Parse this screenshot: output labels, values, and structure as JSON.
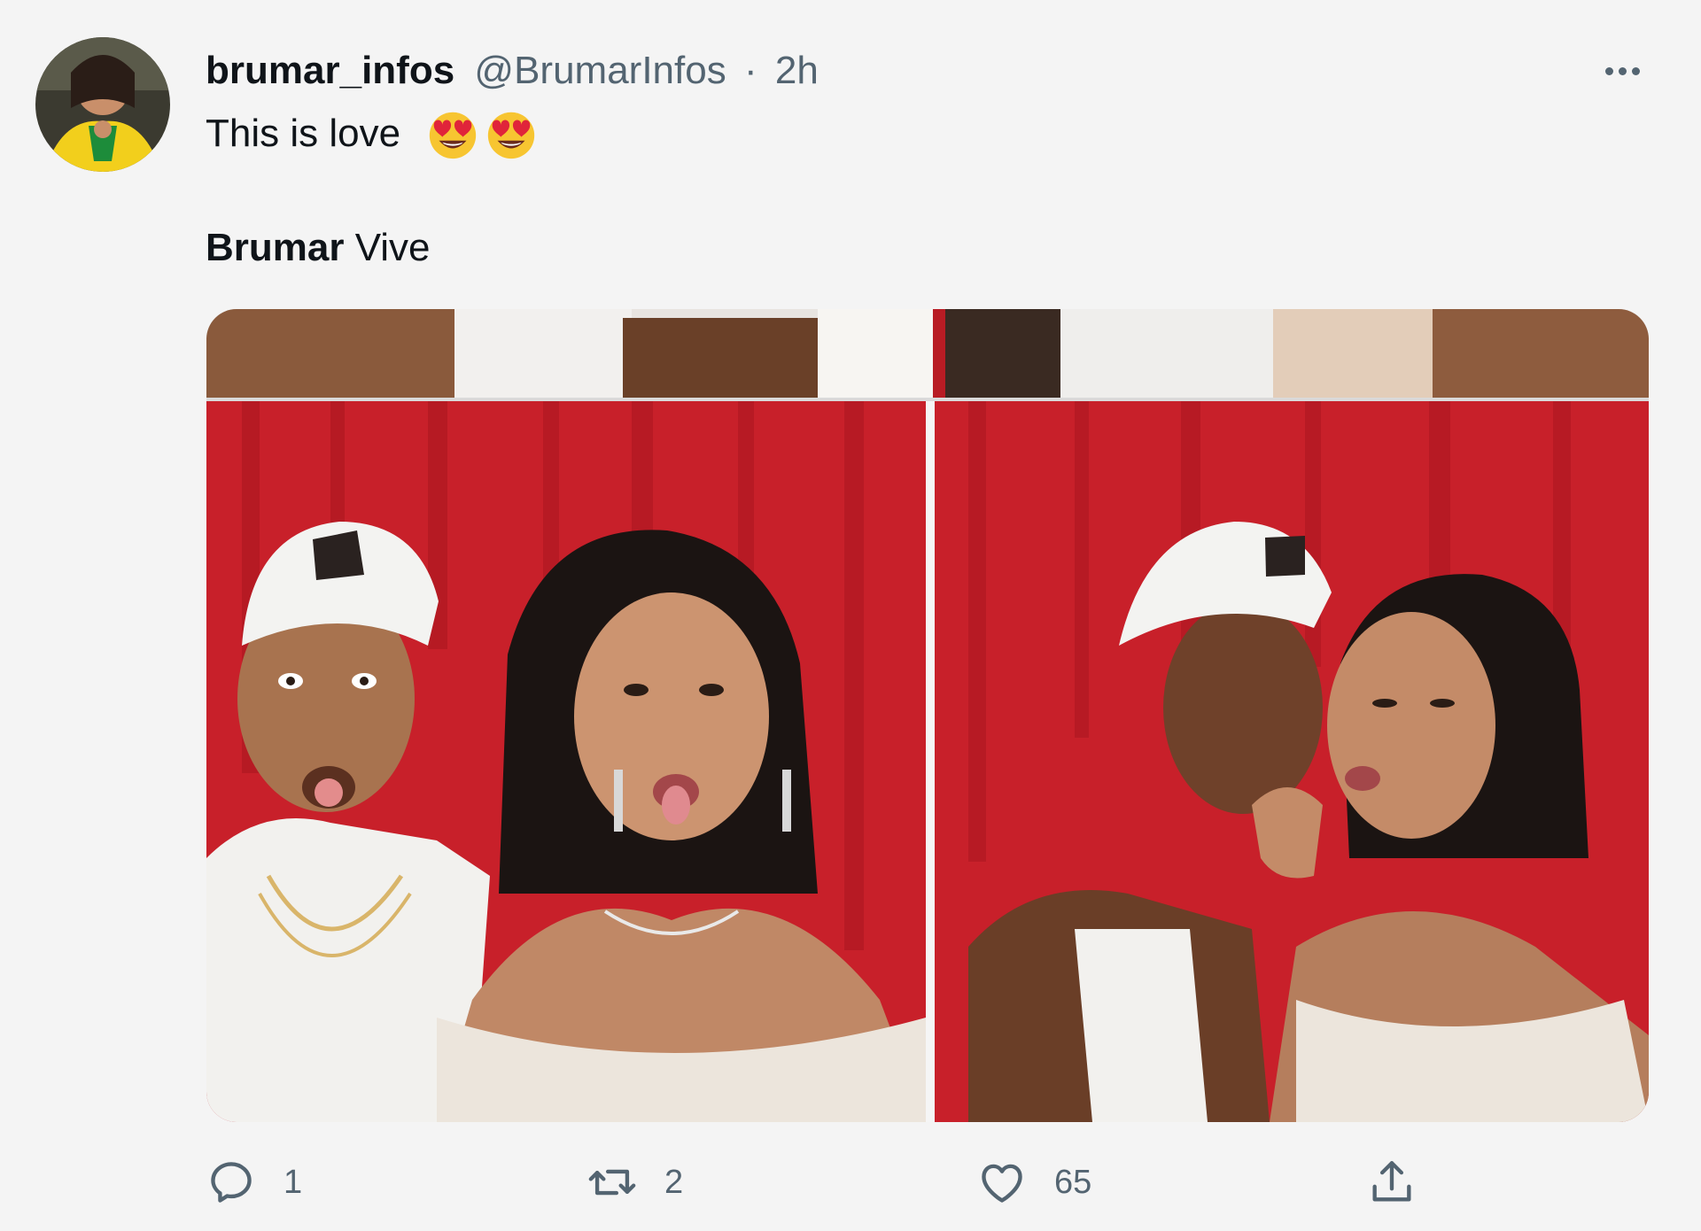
{
  "tweet": {
    "display_name": "brumar_infos",
    "handle": "@BrumarInfos",
    "separator": "·",
    "time": "2h",
    "text": "This is love",
    "emojis": [
      "smiling-face-with-heart-eyes",
      "smiling-face-with-heart-eyes"
    ],
    "quote_bold": "Brumar",
    "quote_rest": " Vive"
  },
  "actions": {
    "reply_count": "1",
    "retweet_count": "2",
    "like_count": "65",
    "share_label": ""
  },
  "icons": {
    "avatar": "avatar-image",
    "more": "more-dots-icon",
    "reply": "reply-icon",
    "retweet": "retweet-icon",
    "like": "heart-icon",
    "share": "share-icon"
  },
  "colors": {
    "text_primary": "#0f1419",
    "text_secondary": "#536471",
    "background": "#f4f4f4",
    "curtain_red": "#c8202a"
  }
}
